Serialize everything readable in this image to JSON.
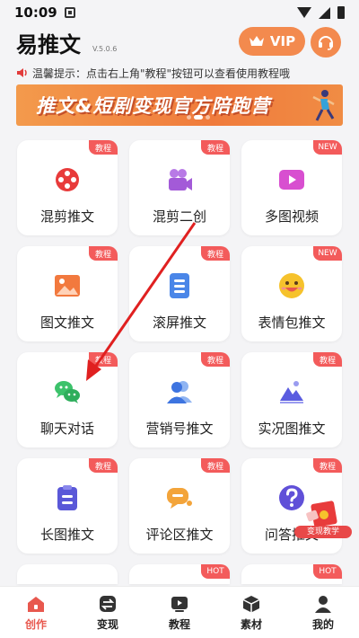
{
  "status_bar": {
    "time": "10:09"
  },
  "header": {
    "title": "易推文",
    "version": "V.5.0.6",
    "vip_label": "VIP"
  },
  "notice": {
    "text": "温馨提示：点击右上角\"教程\"按钮可以查看使用教程哦"
  },
  "banner": {
    "text": "推文&短剧变现官方陪跑营"
  },
  "tiles": [
    {
      "label": "混剪推文",
      "badge": "教程",
      "icon": "film-reel-icon",
      "color": "#e83b3b"
    },
    {
      "label": "混剪二创",
      "badge": "教程",
      "icon": "video-camera-icon",
      "color": "#a35ad8"
    },
    {
      "label": "多图视频",
      "badge": "NEW",
      "icon": "play-video-icon",
      "color": "#d84fd0"
    },
    {
      "label": "图文推文",
      "badge": "教程",
      "icon": "image-icon",
      "color": "#f2793e"
    },
    {
      "label": "滚屏推文",
      "badge": "教程",
      "icon": "document-list-icon",
      "color": "#4a86e8"
    },
    {
      "label": "表情包推文",
      "badge": "NEW",
      "icon": "emoji-face-icon",
      "color": "#f6b52c"
    },
    {
      "label": "聊天对话",
      "badge": "教程",
      "icon": "wechat-icon",
      "color": "#3cc26b"
    },
    {
      "label": "营销号推文",
      "badge": "教程",
      "icon": "contacts-icon",
      "color": "#3d74e0"
    },
    {
      "label": "实况图推文",
      "badge": "教程",
      "icon": "mountain-photo-icon",
      "color": "#5a5ce0"
    },
    {
      "label": "长图推文",
      "badge": "教程",
      "icon": "clipboard-icon",
      "color": "#5a58d8"
    },
    {
      "label": "评论区推文",
      "badge": "教程",
      "icon": "comment-bubble-icon",
      "color": "#f3a43a"
    },
    {
      "label": "问答推文",
      "badge": "教程",
      "icon": "question-icon",
      "color": "#6050d8"
    }
  ],
  "partial_tiles": [
    {
      "badge": ""
    },
    {
      "badge": "HOT"
    },
    {
      "badge": "HOT"
    }
  ],
  "floating": {
    "label": "变现教学"
  },
  "nav": [
    {
      "label": "创作",
      "icon": "home-icon",
      "active": true
    },
    {
      "label": "变现",
      "icon": "exchange-icon",
      "active": false
    },
    {
      "label": "教程",
      "icon": "video-tutorial-icon",
      "active": false
    },
    {
      "label": "素材",
      "icon": "cube-icon",
      "active": false
    },
    {
      "label": "我的",
      "icon": "user-icon",
      "active": false
    }
  ]
}
